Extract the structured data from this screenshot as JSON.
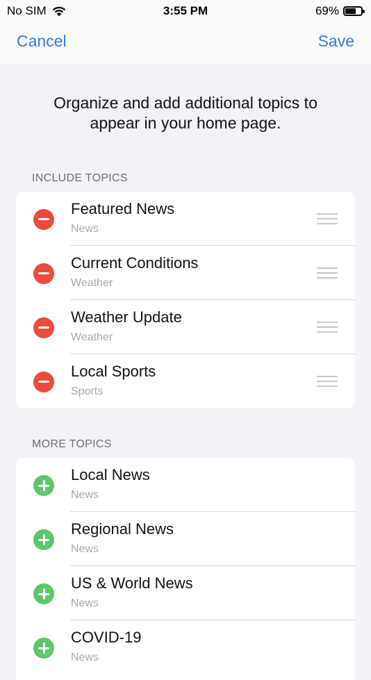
{
  "status": {
    "carrier": "No SIM",
    "time": "3:55 PM",
    "battery_text": "69%",
    "battery_level": 0.69
  },
  "nav": {
    "cancel_label": "Cancel",
    "save_label": "Save"
  },
  "intro_text": "Organize and add additional topics to appear in your home page.",
  "include_section": {
    "header": "INCLUDE TOPICS",
    "items": [
      {
        "title": "Featured News",
        "subtitle": "News"
      },
      {
        "title": "Current Conditions",
        "subtitle": "Weather"
      },
      {
        "title": "Weather Update",
        "subtitle": "Weather"
      },
      {
        "title": "Local Sports",
        "subtitle": "Sports"
      }
    ]
  },
  "more_section": {
    "header": "MORE TOPICS",
    "items": [
      {
        "title": "Local News",
        "subtitle": "News"
      },
      {
        "title": "Regional News",
        "subtitle": "News"
      },
      {
        "title": "US & World News",
        "subtitle": "News"
      },
      {
        "title": "COVID-19",
        "subtitle": "News"
      }
    ]
  },
  "colors": {
    "accent": "#2f7bf6",
    "remove": "#ec4b3b",
    "add": "#5cc86a"
  }
}
